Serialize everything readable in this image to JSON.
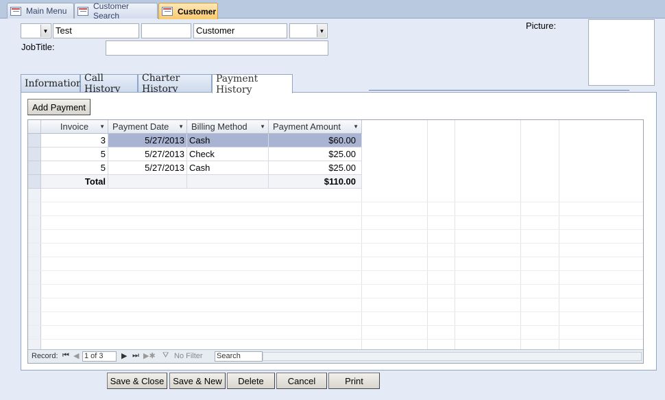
{
  "doc_tabs": [
    {
      "label": "Main Menu",
      "icon": "form-icon"
    },
    {
      "label": "Customer Search",
      "icon": "form-icon"
    },
    {
      "label": "Customer",
      "icon": "form-icon",
      "active": true
    }
  ],
  "header": {
    "title_value": "",
    "first_name": "Test",
    "middle_name": "",
    "last_name": "Customer",
    "suffix_value": "",
    "jobtitle_label": "JobTitle:",
    "jobtitle_value": "",
    "picture_label": "Picture:"
  },
  "form_tabs": [
    "Information",
    "Call History",
    "Charter History",
    "Payment History"
  ],
  "active_tab": "Payment History",
  "add_payment_label": "Add Payment",
  "datasheet": {
    "columns": [
      "Invoice",
      "Payment Date",
      "Billing Method",
      "Payment Amount"
    ],
    "rows": [
      {
        "invoice": "3",
        "payment_date": "5/27/2013",
        "billing_method": "Cash",
        "payment_amount": "$60.00"
      },
      {
        "invoice": "5",
        "payment_date": "5/27/2013",
        "billing_method": "Check",
        "payment_amount": "$25.00"
      },
      {
        "invoice": "5",
        "payment_date": "5/27/2013",
        "billing_method": "Cash",
        "payment_amount": "$25.00"
      }
    ],
    "total_label": "Total",
    "total_amount": "$110.00"
  },
  "navbar": {
    "record_label": "Record:",
    "record_position": "1 of 3",
    "filter_label": "No Filter",
    "search_placeholder": "Search"
  },
  "buttons": {
    "save_close": "Save & Close",
    "save_new": "Save & New",
    "delete": "Delete",
    "cancel": "Cancel",
    "print": "Print"
  }
}
